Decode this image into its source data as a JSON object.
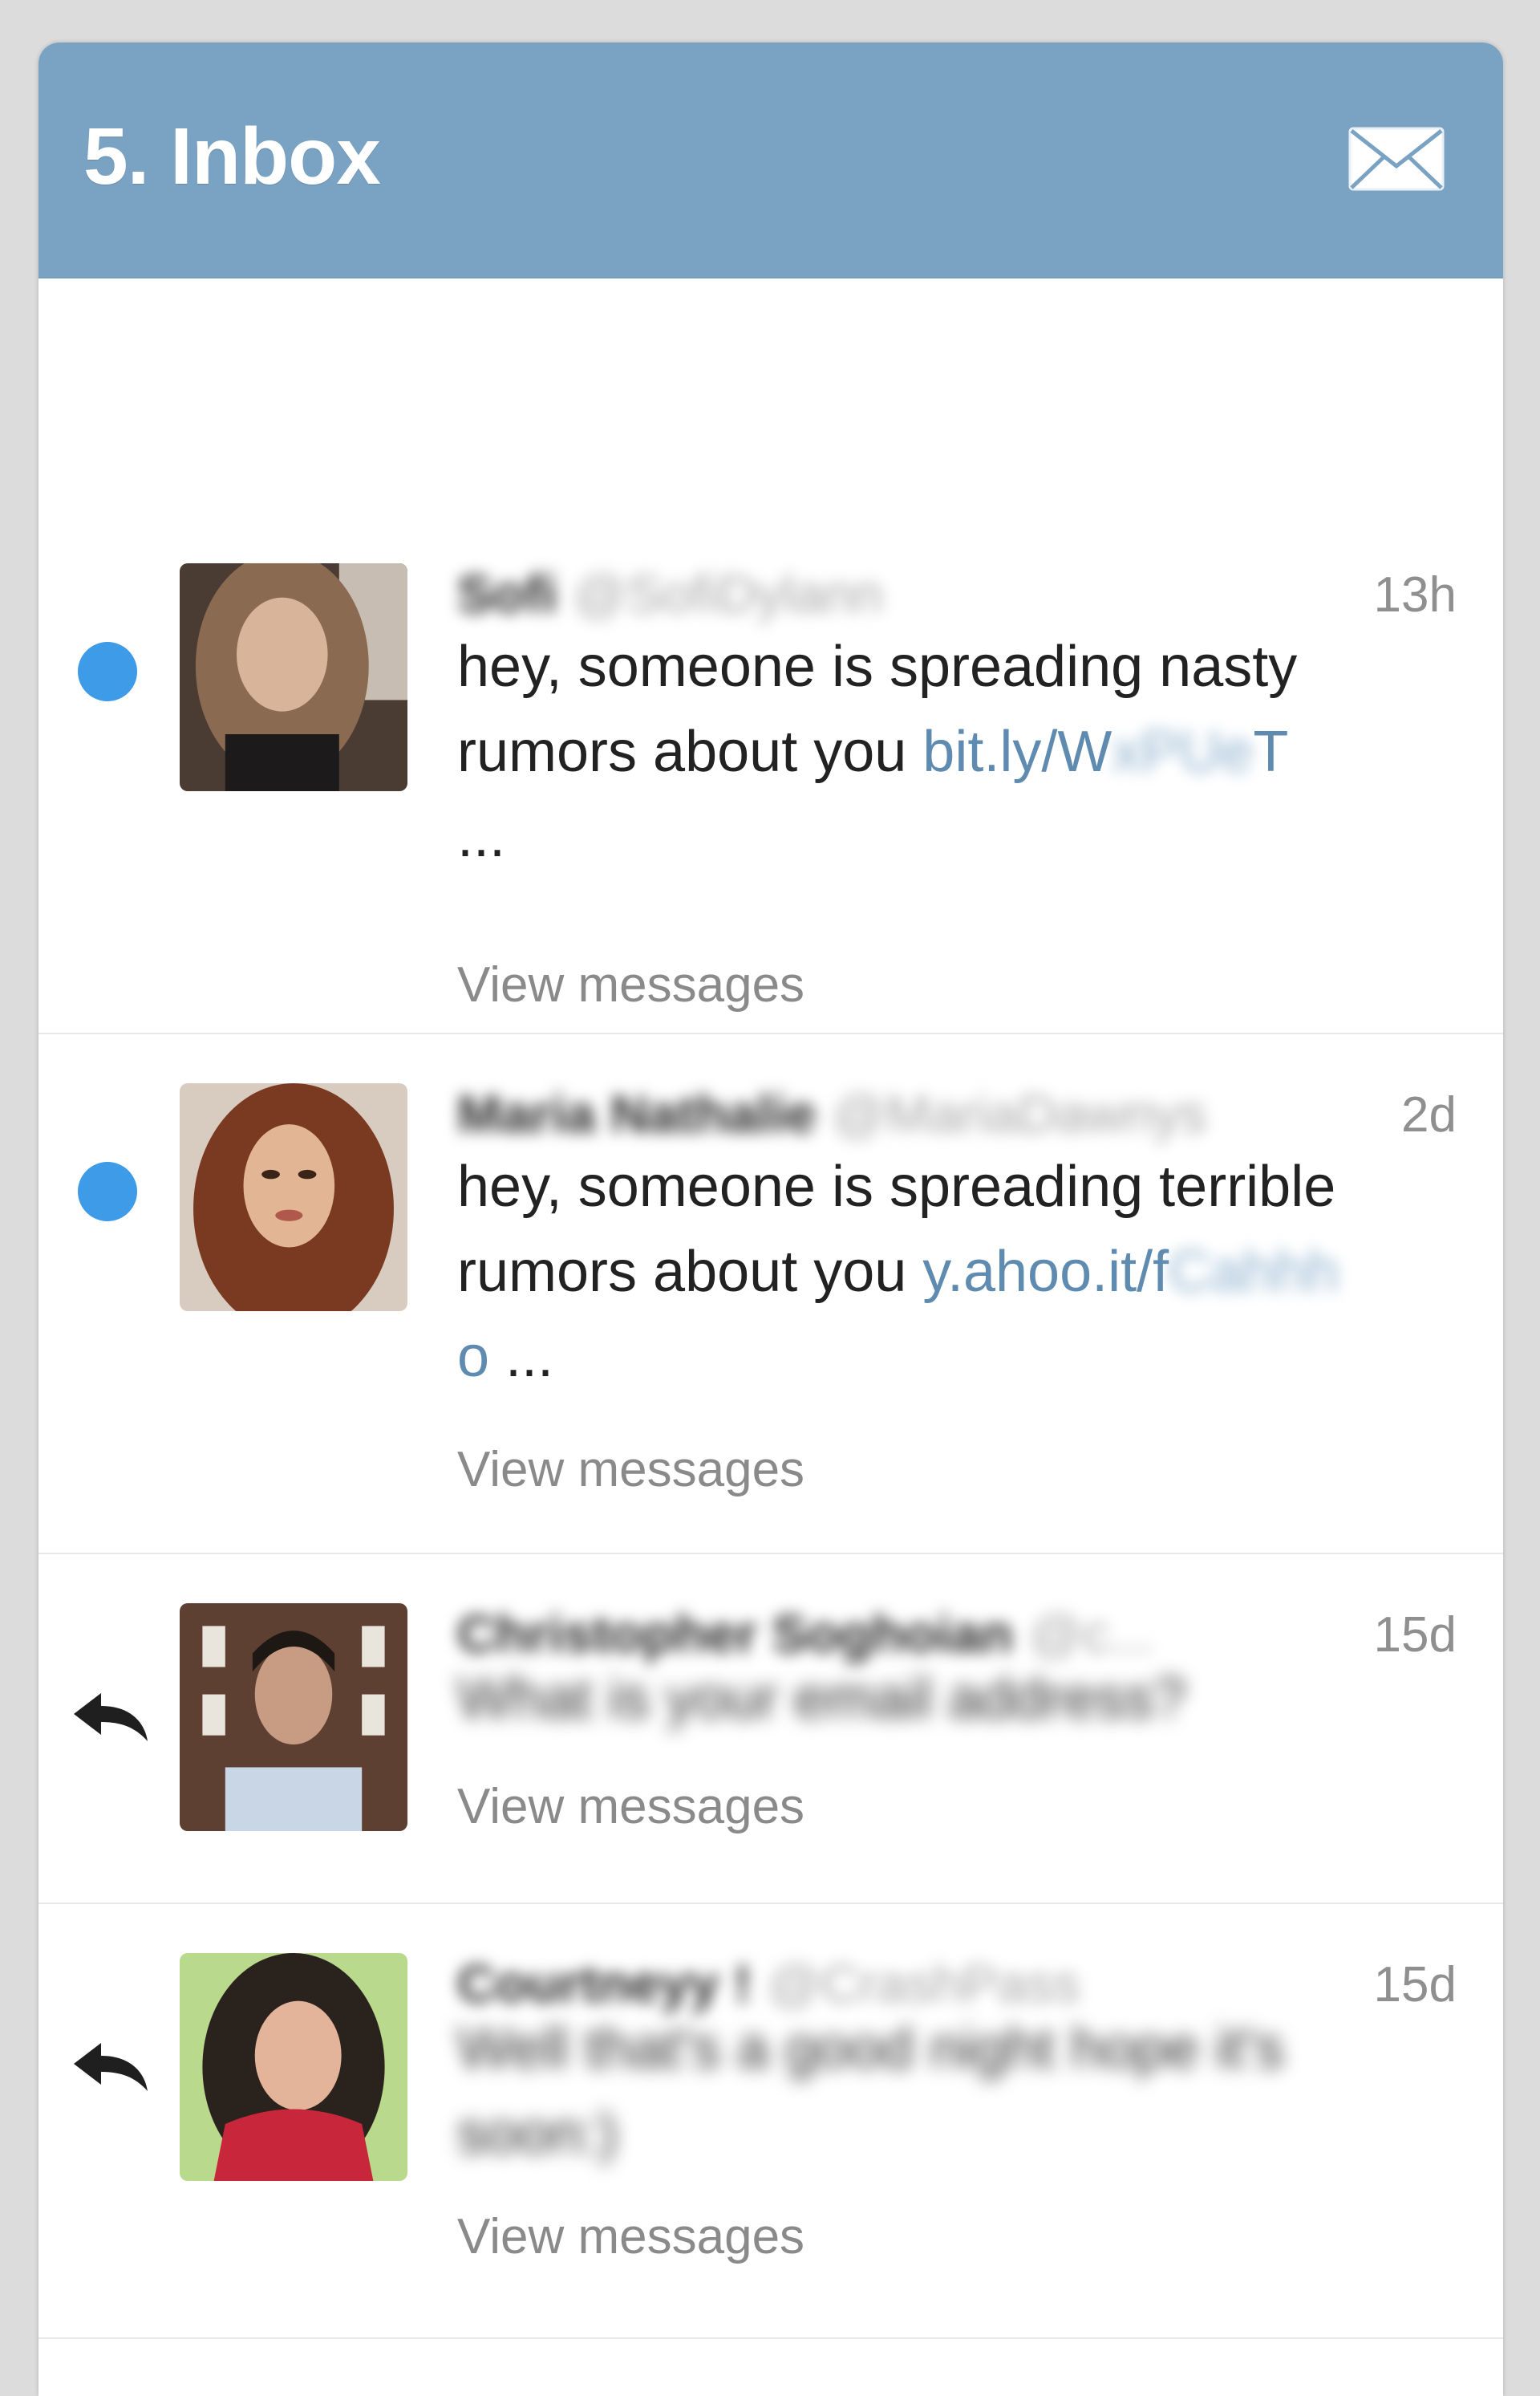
{
  "header": {
    "title": "5. Inbox",
    "icon": "envelope-icon",
    "background": "#7aa2c3"
  },
  "messages": [
    {
      "status": "unread",
      "sender": "Sofi",
      "handle": "@SofiDylann",
      "time": "13h",
      "body_prefix": "hey, someone is spreading nasty rumors about you ",
      "link_start": "bit.ly/W",
      "link_blurred": "xPUe",
      "link_end": "T",
      "body_suffix": "...",
      "view_label": "View messages"
    },
    {
      "status": "unread",
      "sender": "Maria Nathalie",
      "handle": "@MariaDawnys",
      "time": "2d",
      "body_prefix": "hey, someone is spreading terrible rumors about you ",
      "link_start": "y.ahoo.it/f",
      "link_blurred": "Cahhh",
      "link_end": "o",
      "body_suffix": " ...",
      "view_label": "View messages"
    },
    {
      "status": "replied",
      "sender": "Christopher Soghoian",
      "handle": "@c...",
      "time": "15d",
      "body": "What is your email address?",
      "view_label": "View messages"
    },
    {
      "status": "replied",
      "sender": "Courtneyy !",
      "handle": "@CrashPass",
      "time": "15d",
      "body": "Well that's a good night hope it's soon:)",
      "view_label": "View messages"
    }
  ],
  "colors": {
    "unread_dot": "#3e9be8",
    "link": "#5f8bb0",
    "muted": "#8a8a8a"
  }
}
